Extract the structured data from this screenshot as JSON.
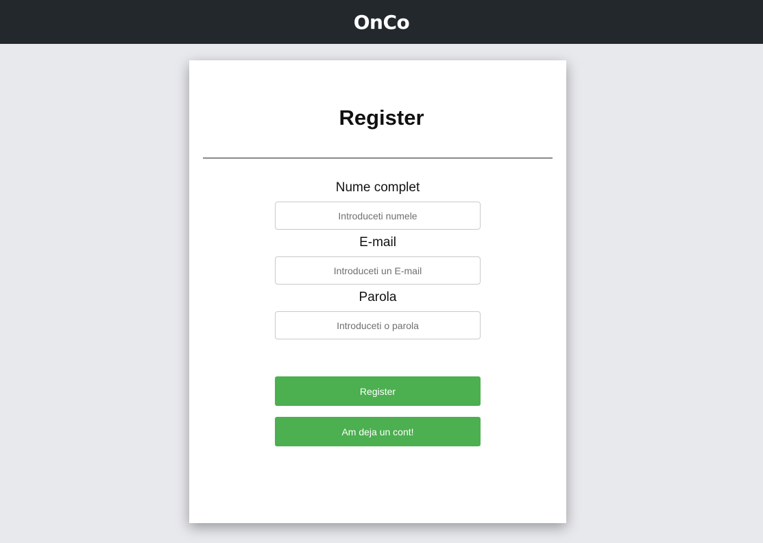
{
  "header": {
    "logo_text": "OnCo",
    "background_color": "#23282d"
  },
  "form": {
    "title": "Register",
    "fields": [
      {
        "label": "Nume complet",
        "placeholder": "Introduceti numele",
        "value": ""
      },
      {
        "label": "E-mail",
        "placeholder": "Introduceti un E-mail",
        "value": ""
      },
      {
        "label": "Parola",
        "placeholder": "Introduceti o parola",
        "value": ""
      }
    ],
    "register_button": "Register",
    "login_button": "Am deja un cont!"
  },
  "colors": {
    "accent": "#4caf50",
    "page_background": "#e8e9ed",
    "card_background": "#ffffff"
  }
}
